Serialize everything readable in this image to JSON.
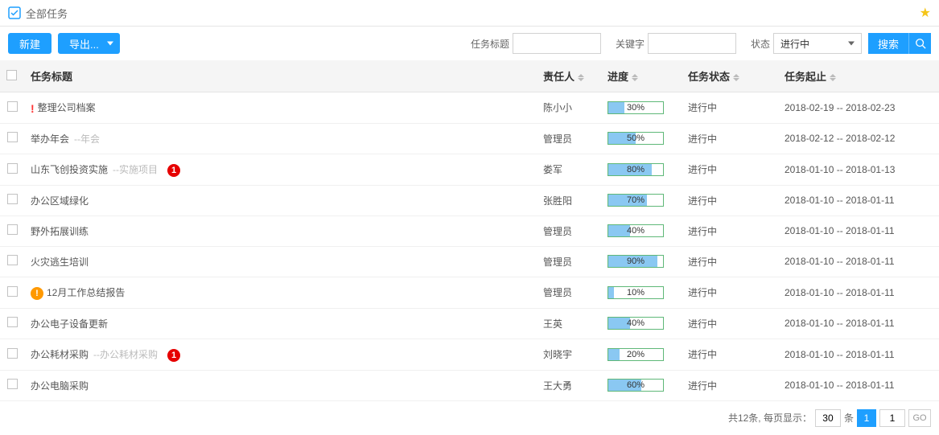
{
  "header": {
    "title": "全部任务"
  },
  "toolbar": {
    "new_label": "新建",
    "export_label": "导出...",
    "title_label": "任务标题",
    "keyword_label": "关键字",
    "status_label": "状态",
    "status_value": "进行中",
    "search_label": "搜索"
  },
  "columns": {
    "title": "任务标题",
    "owner": "责任人",
    "progress": "进度",
    "status": "任务状态",
    "dates": "任务起止"
  },
  "rows": [
    {
      "icon": "excl-red",
      "title": "整理公司档案",
      "tag": "",
      "badge": "",
      "owner": "陈小小",
      "progress": 30,
      "status": "进行中",
      "dates": "2018-02-19 -- 2018-02-23"
    },
    {
      "icon": "",
      "title": "举办年会",
      "tag": "--年会",
      "badge": "",
      "owner": "管理员",
      "progress": 50,
      "status": "进行中",
      "dates": "2018-02-12 -- 2018-02-12"
    },
    {
      "icon": "",
      "title": "山东飞创投资实施",
      "tag": "--实施项目",
      "badge": "1",
      "owner": "娄军",
      "progress": 80,
      "status": "进行中",
      "dates": "2018-01-10 -- 2018-01-13"
    },
    {
      "icon": "",
      "title": "办公区域绿化",
      "tag": "",
      "badge": "",
      "owner": "张胜阳",
      "progress": 70,
      "status": "进行中",
      "dates": "2018-01-10 -- 2018-01-11"
    },
    {
      "icon": "",
      "title": "野外拓展训练",
      "tag": "",
      "badge": "",
      "owner": "管理员",
      "progress": 40,
      "status": "进行中",
      "dates": "2018-01-10 -- 2018-01-11"
    },
    {
      "icon": "",
      "title": "火灾逃生培训",
      "tag": "",
      "badge": "",
      "owner": "管理员",
      "progress": 90,
      "status": "进行中",
      "dates": "2018-01-10 -- 2018-01-11"
    },
    {
      "icon": "excl-orange",
      "title": "12月工作总结报告",
      "tag": "",
      "badge": "",
      "owner": "管理员",
      "progress": 10,
      "status": "进行中",
      "dates": "2018-01-10 -- 2018-01-11"
    },
    {
      "icon": "",
      "title": "办公电子设备更新",
      "tag": "",
      "badge": "",
      "owner": "王英",
      "progress": 40,
      "status": "进行中",
      "dates": "2018-01-10 -- 2018-01-11"
    },
    {
      "icon": "",
      "title": "办公耗材采购",
      "tag": "--办公耗材采购",
      "badge": "1",
      "owner": "刘晓宇",
      "progress": 20,
      "status": "进行中",
      "dates": "2018-01-10 -- 2018-01-11"
    },
    {
      "icon": "",
      "title": "办公电脑采购",
      "tag": "",
      "badge": "",
      "owner": "王大勇",
      "progress": 60,
      "status": "进行中",
      "dates": "2018-01-10 -- 2018-01-11"
    }
  ],
  "pager": {
    "total_text": "共12条, 每页显示：",
    "page_size": "30",
    "unit": "条",
    "current_page": "1",
    "goto_page": "1",
    "go_label": "GO"
  }
}
